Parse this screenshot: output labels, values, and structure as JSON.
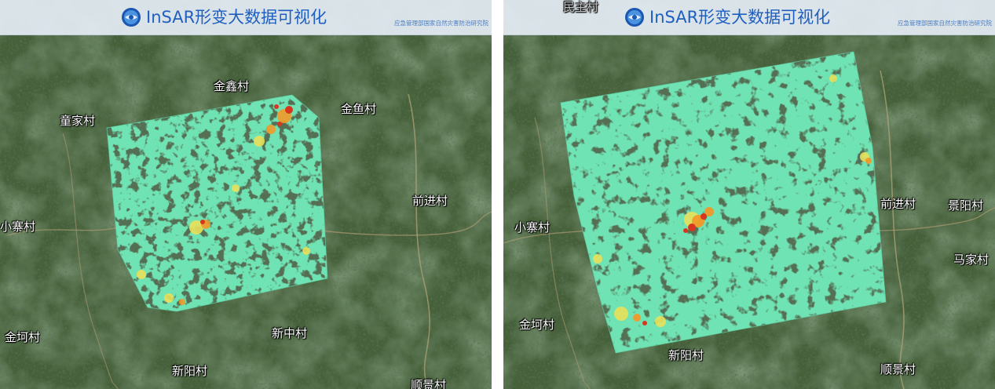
{
  "header": {
    "title": "InSAR形变大数据可视化",
    "subtitle": "应急管理部国家自然灾害防治研究院",
    "logo_icon": "globe-logo-icon"
  },
  "left_panel": {
    "places": [
      "金鑫村",
      "童家村",
      "金鱼村",
      "前进村",
      "小寨村",
      "金坷村",
      "新中村",
      "新阳村",
      "顺景村"
    ]
  },
  "right_panel": {
    "places": [
      "民主村",
      "前进村",
      "景阳村",
      "小寨村",
      "马家村",
      "金坷村",
      "新阳村",
      "顺景村"
    ]
  },
  "legend_colors": {
    "stable": "#6fe3b4",
    "minor": "#e8e05a",
    "moderate": "#f09a2a",
    "severe": "#d8351e"
  }
}
